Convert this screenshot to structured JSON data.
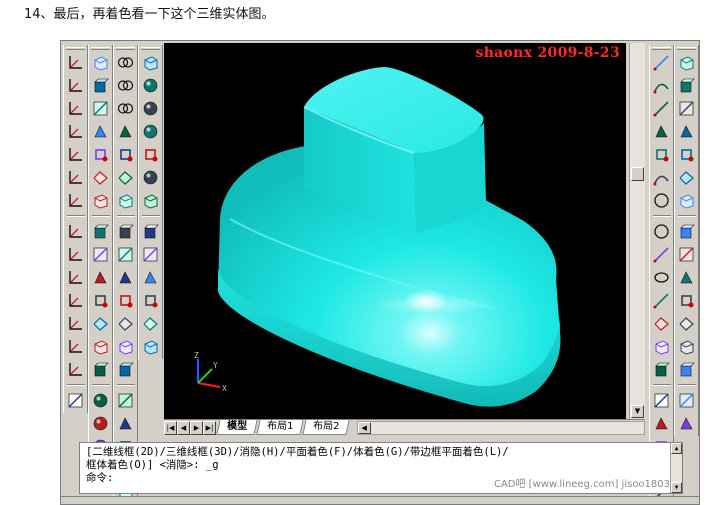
{
  "caption": "14、最后，再着色看一下这个三维实体图。",
  "viewport": {
    "watermark": "shaonx 2009-8-23",
    "background": "#000000",
    "solid_color": "#1ee8e4",
    "ucs_axes": {
      "z": "Z",
      "y": "Y",
      "x": "X"
    }
  },
  "toolbars": {
    "col1": [
      "ucs-icon",
      "world-ucs-icon",
      "ucs-previous-icon",
      "object-ucs-icon",
      "face-ucs-icon",
      "view-ucs-icon",
      "origin-ucs-icon",
      "zaxis-ucs-icon",
      "3point-ucs-icon",
      "x-rotate-ucs-icon",
      "y-rotate-ucs-icon",
      "z-rotate-ucs-icon",
      "apply-ucs-icon",
      "named-ucs-icon",
      "orbit-icon"
    ],
    "col2": [
      "view-manager-icon",
      "top-view-icon",
      "bottom-view-icon",
      "left-view-icon",
      "right-view-icon",
      "front-view-icon",
      "back-view-icon",
      "sw-iso-icon",
      "se-iso-icon",
      "ne-iso-icon",
      "nw-iso-icon",
      "camera-icon",
      "box-icon",
      "wedge-icon",
      "cone-icon",
      "cylinder-icon",
      "sphere-icon",
      "torus-icon"
    ],
    "col3": [
      "union-icon",
      "subtract-icon",
      "intersect-icon",
      "extrude-icon",
      "revolve-icon",
      "slice-icon",
      "section-icon",
      "interfere-icon",
      "setup-drawing-icon",
      "setup-view-icon",
      "setup-profile-icon",
      "extrude-faces-icon",
      "move-faces-icon",
      "offset-faces-icon",
      "delete-faces-icon",
      "rotate-faces-icon",
      "taper-faces-icon",
      "copy-faces-icon",
      "color-faces-icon"
    ],
    "col4": [
      "box-solid-icon",
      "sphere-solid-icon",
      "cylinder-solid-icon",
      "cone-solid-icon",
      "wedge-solid-icon",
      "torus-solid-icon",
      "2d-wireframe-icon",
      "3d-wireframe-icon",
      "hidden-icon",
      "flat-shaded-icon",
      "gouraud-shaded-icon",
      "flat-edges-icon",
      "gouraud-edges-icon"
    ],
    "right1": [
      "line-icon",
      "construction-line-icon",
      "polyline-icon",
      "polygon-icon",
      "rectangle-icon",
      "arc-icon",
      "circle-icon",
      "revision-cloud-icon",
      "spline-icon",
      "ellipse-icon",
      "ellipse-arc-icon",
      "insert-block-icon",
      "make-block-icon",
      "point-icon",
      "hatch-icon",
      "gradient-icon",
      "region-icon",
      "table-icon",
      "multiline-text-icon"
    ],
    "right2": [
      "erase-icon",
      "copy-icon",
      "mirror-icon",
      "offset-icon",
      "array-icon",
      "move-icon",
      "rotate-icon",
      "scale-icon",
      "stretch-icon",
      "trim-icon",
      "extend-icon",
      "break-icon",
      "join-icon",
      "chamfer-icon",
      "fillet-icon",
      "explode-icon"
    ]
  },
  "tabs": {
    "model": "模型",
    "layout1": "布局1",
    "layout2": "布局2"
  },
  "command": {
    "line1": "[二维线框(2D)/三维线框(3D)/消隐(H)/平面着色(F)/体着色(G)/带边框平面着色(L)/",
    "line2": "框体着色(O)] <消隐>: _g",
    "prompt": "命令:",
    "credit": "CAD吧 [www.lineeg.com] jisoo1803"
  }
}
